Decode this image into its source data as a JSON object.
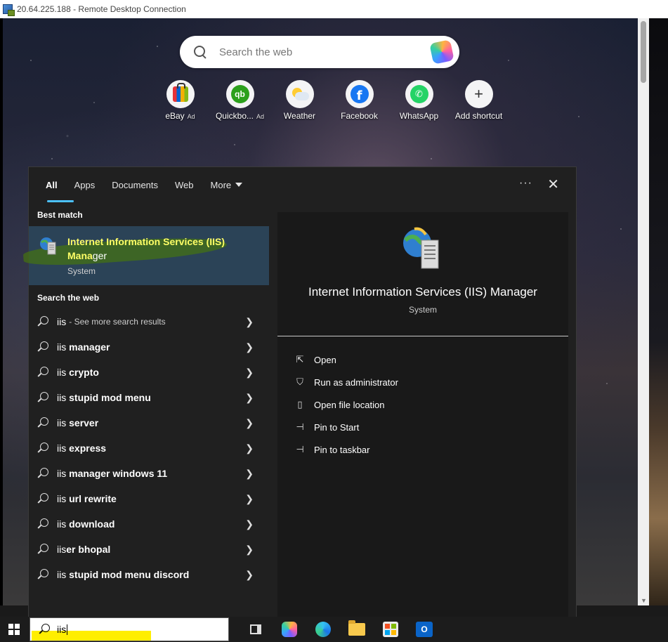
{
  "window": {
    "title": "20.64.225.188 - Remote Desktop Connection"
  },
  "browser_newtab": {
    "search_placeholder": "Search the web",
    "shortcuts": [
      {
        "label": "eBay",
        "ad": "Ad",
        "icon": "ebay-icon"
      },
      {
        "label": "Quickbo...",
        "ad": "Ad",
        "icon": "quickbooks-icon"
      },
      {
        "label": "Weather",
        "ad": "",
        "icon": "weather-icon"
      },
      {
        "label": "Facebook",
        "ad": "",
        "icon": "facebook-icon"
      },
      {
        "label": "WhatsApp",
        "ad": "",
        "icon": "whatsapp-icon"
      },
      {
        "label": "Add shortcut",
        "ad": "",
        "icon": "plus-icon"
      }
    ]
  },
  "search_panel": {
    "tabs": [
      "All",
      "Apps",
      "Documents",
      "Web",
      "More"
    ],
    "active_tab": "All",
    "best_match_heading": "Best match",
    "best_match": {
      "title_highlight": "Internet Information Services (IIS) Mana",
      "title_rest": "ger",
      "type": "System"
    },
    "web_heading": "Search the web",
    "web_results": [
      {
        "prefix": "iis",
        "bold": "",
        "sub": "- See more search results"
      },
      {
        "prefix": "iis ",
        "bold": "manager",
        "sub": ""
      },
      {
        "prefix": "iis ",
        "bold": "crypto",
        "sub": ""
      },
      {
        "prefix": "iis ",
        "bold": "stupid mod menu",
        "sub": ""
      },
      {
        "prefix": "iis ",
        "bold": "server",
        "sub": ""
      },
      {
        "prefix": "iis ",
        "bold": "express",
        "sub": ""
      },
      {
        "prefix": "iis ",
        "bold": "manager windows 11",
        "sub": ""
      },
      {
        "prefix": "iis ",
        "bold": "url rewrite",
        "sub": ""
      },
      {
        "prefix": "iis ",
        "bold": "download",
        "sub": ""
      },
      {
        "prefix": "iis",
        "bold": "er bhopal",
        "sub": ""
      },
      {
        "prefix": "iis ",
        "bold": "stupid mod menu discord",
        "sub": ""
      }
    ],
    "preview": {
      "title": "Internet Information Services (IIS) Manager",
      "subtitle": "System",
      "actions": [
        {
          "label": "Open",
          "icon": "open-icon",
          "glyph": "⇱"
        },
        {
          "label": "Run as administrator",
          "icon": "shield-icon",
          "glyph": "⛉"
        },
        {
          "label": "Open file location",
          "icon": "file-location-icon",
          "glyph": "▯"
        },
        {
          "label": "Pin to Start",
          "icon": "pin-icon",
          "glyph": "⊣"
        },
        {
          "label": "Pin to taskbar",
          "icon": "pin-icon",
          "glyph": "⊣"
        }
      ]
    }
  },
  "taskbar": {
    "search_value": "iis",
    "apps": [
      "task-view-icon",
      "copilot-icon",
      "edge-icon",
      "file-explorer-icon",
      "store-icon",
      "outlook-icon"
    ]
  },
  "colors": {
    "panel_bg": "#202020",
    "selected_bg": "#2b4357",
    "accent": "#4cc2ff",
    "highlight": "#ffff66"
  }
}
